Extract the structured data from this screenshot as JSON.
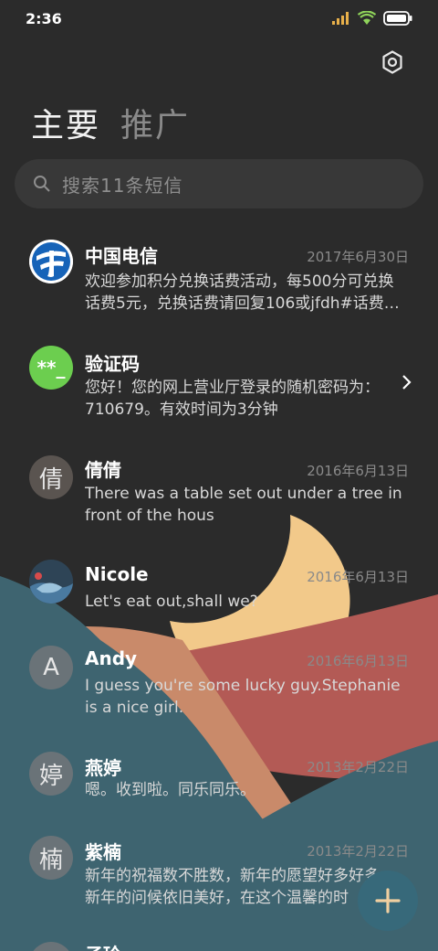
{
  "status_bar": {
    "time": "2:36",
    "icons": [
      "signal-icon",
      "wifi-icon",
      "battery-icon"
    ]
  },
  "header": {
    "tabs": [
      {
        "label": "主要",
        "active": true
      },
      {
        "label": "推广",
        "active": false
      }
    ],
    "settings_icon": "gear-icon"
  },
  "search": {
    "placeholder": "搜索11条短信",
    "icon": "search-icon"
  },
  "messages": [
    {
      "name": "中国电信",
      "date": "2017年6月30日",
      "lines": [
        "欢迎参加积分兑换话费活动，每500分可兑换",
        "话费5元，兑换话费请回复106或jfdh#话费…"
      ],
      "avatar_type": "logo-china-telecom"
    },
    {
      "name": "验证码",
      "date": "",
      "lines": [
        "您好！您的网上营业厅登录的随机密码为：",
        "710679。有效时间为3分钟"
      ],
      "avatar_text": "**_",
      "avatar_color": "#6cce4f"
    },
    {
      "name": "倩倩",
      "date": "2016年6月13日",
      "lines": [
        "There was a table set out under a tree in",
        "front of the hous"
      ],
      "avatar_text": "倩"
    },
    {
      "name": "Nicole",
      "date": "2016年6月13日",
      "lines": [
        "Let's eat out,shall we?"
      ],
      "avatar_type": "photo-whale"
    },
    {
      "name": "Andy",
      "date": "2016年6月13日",
      "lines": [
        "I guess you're some lucky guy.Stephanie",
        "is a nice girl."
      ],
      "avatar_text": "A"
    },
    {
      "name": "燕婷",
      "date": "2013年2月22日",
      "lines": [
        "嗯。收到啦。同乐同乐。"
      ],
      "avatar_text": "婷"
    },
    {
      "name": "紫楠",
      "date": "2013年2月22日",
      "lines": [
        "新年的祝福数不胜数，新年的愿望好多好多",
        "新年的问候依旧美好，在这个温馨的时"
      ],
      "avatar_text": "楠"
    },
    {
      "name": "子玲",
      "date": "",
      "lines": [],
      "avatar_text": ""
    }
  ],
  "fab": {
    "icon": "plus-icon"
  },
  "colors": {
    "background": "#2b2b2b",
    "search_bg": "#383838",
    "teal": "#3e6470",
    "peach": "#c98a6a",
    "red": "#b35a55",
    "moon": "#f2c98a",
    "fab": "#37697a"
  }
}
